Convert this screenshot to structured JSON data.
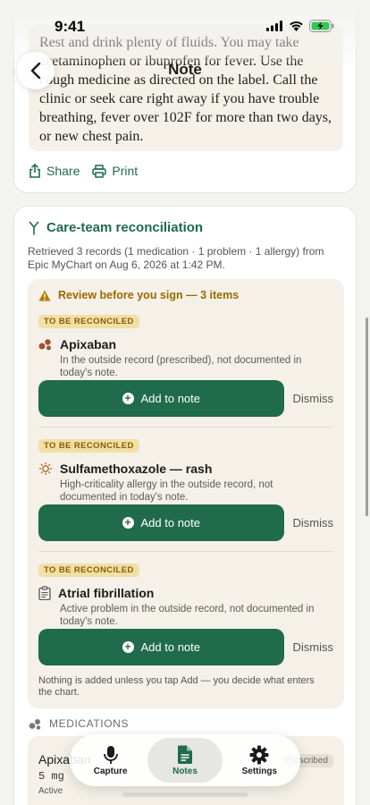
{
  "status_bar": {
    "time": "9:41"
  },
  "nav": {
    "title": "Note",
    "back_icon": "chevron-left-icon"
  },
  "note": {
    "text": "Rest and drink plenty of fluids. You may take acetaminophen or ibuprofen for fever. Use the cough medicine as directed on the label. Call the clinic or seek care right away if you have trouble breathing, fever over 102F for more than two days, or new chest pain.",
    "share_label": "Share",
    "print_label": "Print"
  },
  "reconciliation": {
    "title": "Care-team reconciliation",
    "description": "Retrieved 3 records (1 medication · 1 problem · 1 allergy) from Epic MyChart on Aug 6, 2026 at 1:42 PM.",
    "review_header": "Review before you sign — 3 items",
    "items": [
      {
        "badge": "TO BE RECONCILED",
        "icon": "pill-icon",
        "title": "Apixaban",
        "subtitle": "In the outside record (prescribed), not documented in today's note.",
        "add_label": "Add to note",
        "dismiss_label": "Dismiss"
      },
      {
        "badge": "TO BE RECONCILED",
        "icon": "allergy-icon",
        "title": "Sulfamethoxazole — rash",
        "subtitle": "High-criticality allergy in the outside record, not documented in today's note.",
        "add_label": "Add to note",
        "dismiss_label": "Dismiss"
      },
      {
        "badge": "TO BE RECONCILED",
        "icon": "clipboard-icon",
        "title": "Atrial fibrillation",
        "subtitle": "Active problem in the outside record, not documented in today's note.",
        "add_label": "Add to note",
        "dismiss_label": "Dismiss"
      }
    ],
    "footnote": "Nothing is added unless you tap Add — you decide what enters the chart."
  },
  "medications": {
    "header": "MEDICATIONS",
    "items": [
      {
        "name": "Apixaban",
        "dose": "5 mg",
        "state": "Active",
        "badge": "Prescribed"
      }
    ]
  },
  "tab_bar": {
    "tabs": [
      {
        "label": "Capture",
        "icon": "microphone-icon",
        "active": false
      },
      {
        "label": "Notes",
        "icon": "document-icon",
        "active": true
      },
      {
        "label": "Settings",
        "icon": "gear-icon",
        "active": false
      }
    ]
  },
  "colors": {
    "accent": "#1f6b4c",
    "warning": "#9a6a00",
    "panel": "#f5f1e8",
    "background": "#f3f3f1"
  }
}
